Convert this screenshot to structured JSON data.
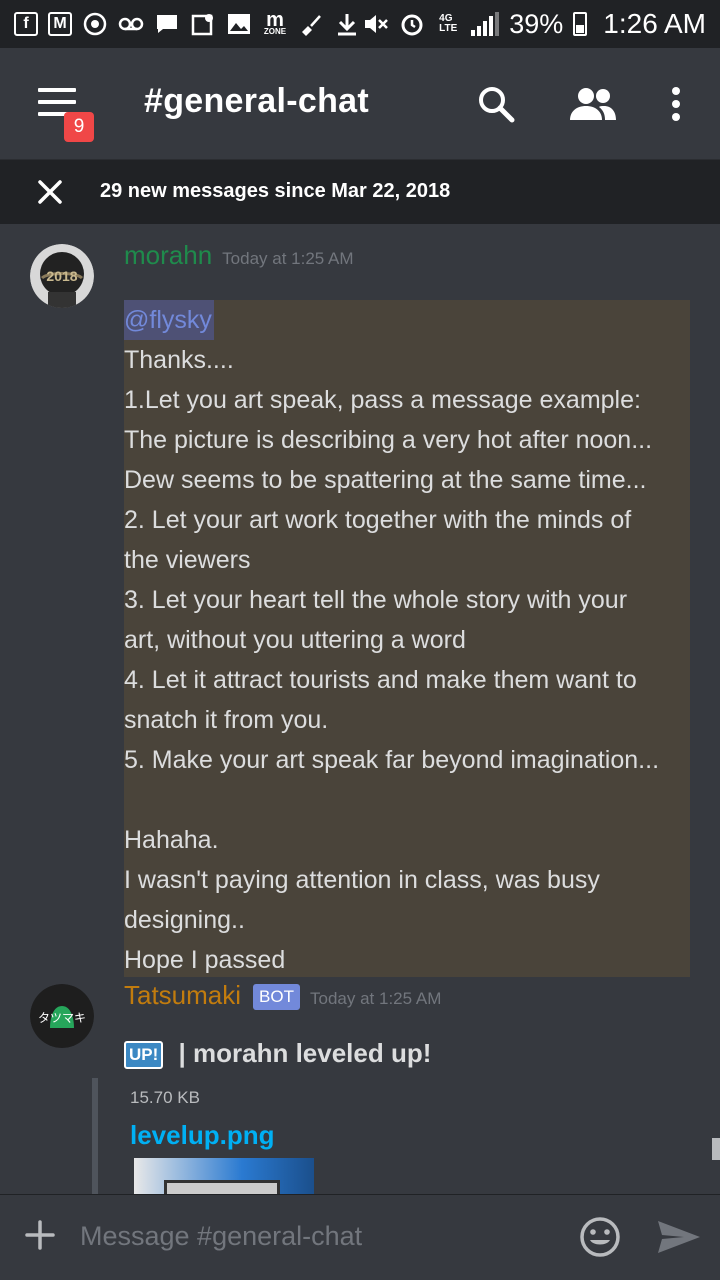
{
  "status_bar": {
    "battery_percent": "39%",
    "time": "1:26 AM",
    "left_icons": [
      "facebook-icon",
      "gmail-icon",
      "chrome-icon",
      "voicemail-icon",
      "message-icon",
      "maps-icon",
      "gallery-icon",
      "zone-icon",
      "clean-icon",
      "download-icon"
    ],
    "right_icons": [
      "mute-icon",
      "alarm-icon",
      "lte-icon",
      "signal-icon",
      "battery-icon"
    ]
  },
  "header": {
    "menu_badge": "9",
    "channel_title": "#general-chat"
  },
  "banner": {
    "text": "29 new messages since Mar 22, 2018"
  },
  "messages": [
    {
      "author": "morahn",
      "author_color": "#1f8b4c",
      "timestamp": "Today at 1:25 AM",
      "mention": "@flysky",
      "lines": [
        "Thanks....",
        "1.Let you art speak, pass a message example:",
        "The picture is describing a very hot after noon...",
        "Dew seems to be spattering at the same time...",
        "2. Let your art work together with the minds of",
        "the viewers",
        "3. Let your heart tell the whole story with your",
        "art, without you uttering a word",
        "4. Let it attract tourists and make them want to",
        "snatch it from you.",
        "5. Make your art speak far beyond imagination...",
        "",
        "Hahaha.",
        "I wasn't paying attention in class, was busy",
        "designing..",
        "Hope I passed"
      ],
      "avatar_text": "2018"
    },
    {
      "author": "Tatsumaki",
      "author_color": "#c27c0e",
      "bot_badge": "BOT",
      "timestamp": "Today at 1:25 AM",
      "up_badge": "UP!",
      "text": "| morahn leveled up!",
      "avatar_text": "タツマキ",
      "attachment": {
        "size": "15.70 KB",
        "filename": "levelup.png"
      }
    }
  ],
  "input": {
    "placeholder": "Message #general-chat"
  }
}
